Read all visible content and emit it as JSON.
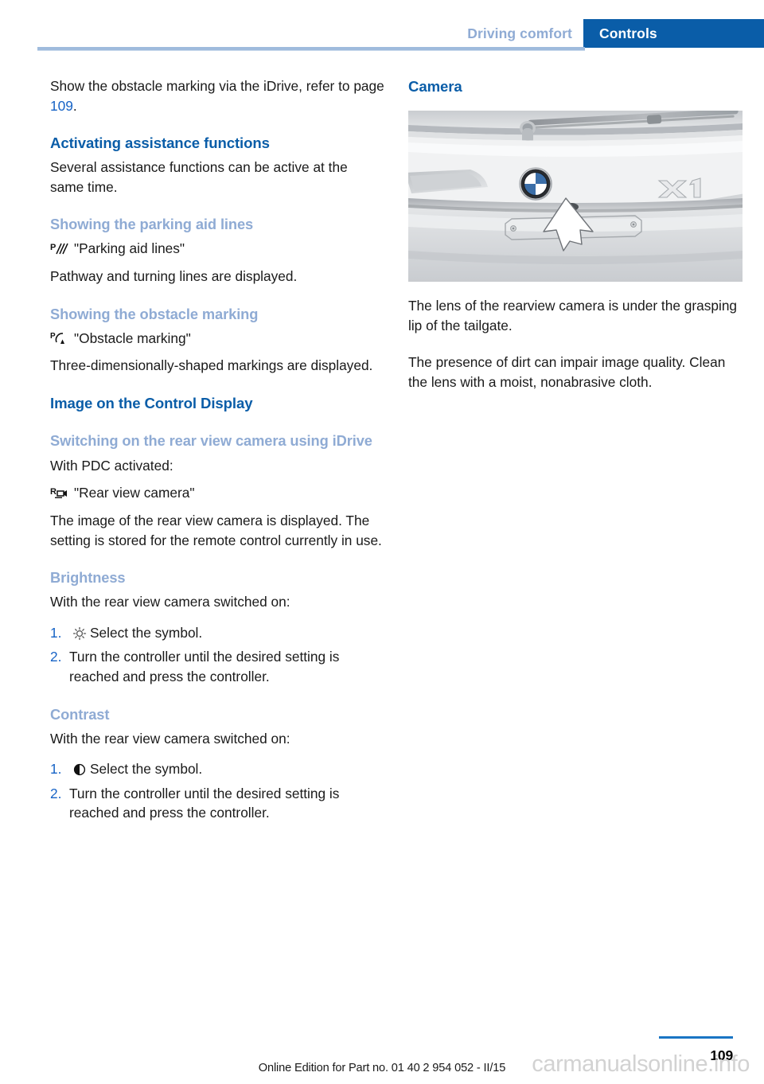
{
  "header": {
    "section_label": "Driving comfort",
    "chapter_label": "Controls",
    "accent_color": "#0a5da8",
    "muted_color": "#8fabd4"
  },
  "left_column": {
    "intro_paragraph_before_link": "Show the obstacle marking via the iDrive, refer to page ",
    "intro_page_link": "109",
    "intro_paragraph_after_link": ".",
    "activating": {
      "heading": "Activating assistance functions",
      "paragraph": "Several assistance functions can be active at the same time."
    },
    "parking_aid_lines": {
      "heading": "Showing the parking aid lines",
      "icon": "parking-aid-lines-icon",
      "menu_label": "\"Parking aid lines\"",
      "paragraph": "Pathway and turning lines are displayed."
    },
    "obstacle_marking": {
      "heading": "Showing the obstacle marking",
      "icon": "obstacle-marking-icon",
      "menu_label": "\"Obstacle marking\"",
      "paragraph": "Three-dimensionally-shaped markings are displayed."
    },
    "control_display": {
      "heading": "Image on the Control Display"
    },
    "switching_on": {
      "heading": "Switching on the rear view camera using iDrive",
      "intro": "With PDC activated:",
      "icon": "rear-view-camera-icon",
      "menu_label": "\"Rear view camera\"",
      "paragraph": "The image of the rear view camera is displayed. The setting is stored for the remote control currently in use."
    },
    "brightness": {
      "heading": "Brightness",
      "intro": "With the rear view camera switched on:",
      "steps": [
        {
          "number": "1.",
          "icon": "brightness-sun-icon",
          "text": "Select the symbol."
        },
        {
          "number": "2.",
          "icon": "",
          "text": "Turn the controller until the desired setting is reached and press the controller."
        }
      ]
    },
    "contrast": {
      "heading": "Contrast",
      "intro": "With the rear view camera switched on:",
      "steps": [
        {
          "number": "1.",
          "icon": "contrast-halfcircle-icon",
          "text": "Select the symbol."
        },
        {
          "number": "2.",
          "icon": "",
          "text": "Turn the controller until the desired setting is reached and press the controller."
        }
      ]
    }
  },
  "right_column": {
    "camera": {
      "heading": "Camera",
      "photo": {
        "name": "bmw-x1-tailgate-camera-photo",
        "badge_text": "X1",
        "marker": "white-arrow-pointing-to-camera-lens",
        "description": "Photograph of a white BMW X1 tailgate showing the BMW roundel, rear wiper, X1 badge and a white arrow indicating the rearview camera location beneath the grasping lip"
      },
      "paragraph_1": "The lens of the rearview camera is under the grasping lip of the tailgate.",
      "paragraph_2": "The presence of dirt can impair image quality. Clean the lens with a moist, nonabrasive cloth."
    }
  },
  "footer": {
    "note": "Online Edition for Part no. 01 40 2 954 052 - II/15",
    "page_number": "109",
    "watermark": "carmanualsonline.info",
    "rule_color": "#1a75c4"
  }
}
